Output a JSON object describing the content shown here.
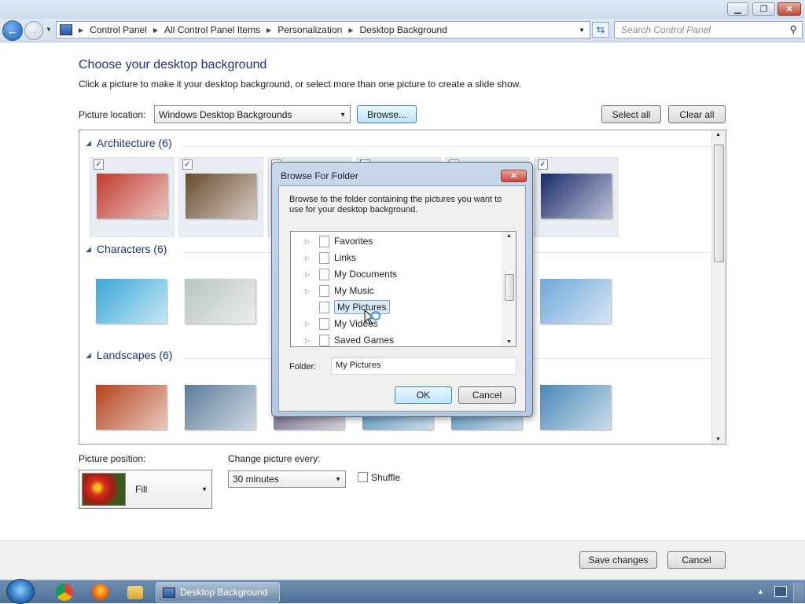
{
  "window": {
    "caption_buttons": [
      "minimize",
      "maximize",
      "close"
    ]
  },
  "address": {
    "crumbs": [
      "Control Panel",
      "All Control Panel Items",
      "Personalization",
      "Desktop Background"
    ],
    "search_placeholder": "Search Control Panel"
  },
  "page": {
    "title": "Choose your desktop background",
    "subtitle": "Click a picture to make it your desktop background, or select more than one picture to create a slide show.",
    "picture_location_label": "Picture location:",
    "picture_location_value": "Windows Desktop Backgrounds",
    "browse_label": "Browse...",
    "select_all_label": "Select all",
    "clear_all_label": "Clear all"
  },
  "gallery": {
    "groups": [
      {
        "title": "Architecture (6)",
        "checked": true,
        "colors": [
          "#c0392b",
          "#6a4a2b",
          "#8fa6c4",
          "#b8a88a",
          "#5a7a9a",
          "#1a2a6a"
        ]
      },
      {
        "title": "Characters (6)",
        "checked": false,
        "colors": [
          "#3aa7d8",
          "#b8c4c0",
          "#9bb0c2",
          "#c4d0dc",
          "#8ab0d0",
          "#6fa8d8"
        ]
      },
      {
        "title": "Landscapes (6)",
        "checked": false,
        "colors": [
          "#b4421c",
          "#5c7c9c",
          "#6a5a7c",
          "#4a88b8",
          "#4a88b8",
          "#4a88b8"
        ]
      }
    ]
  },
  "bottom": {
    "picture_position_label": "Picture position:",
    "picture_position_value": "Fill",
    "change_every_label": "Change picture every:",
    "change_every_value": "30 minutes",
    "shuffle_label": "Shuffle",
    "save_label": "Save changes",
    "cancel_label": "Cancel"
  },
  "dialog": {
    "title": "Browse For Folder",
    "description": "Browse to the folder containing the pictures you want to use for your desktop background.",
    "tree": [
      {
        "label": "Favorites",
        "expandable": true,
        "selected": false
      },
      {
        "label": "Links",
        "expandable": true,
        "selected": false
      },
      {
        "label": "My Documents",
        "expandable": true,
        "selected": false
      },
      {
        "label": "My Music",
        "expandable": true,
        "selected": false
      },
      {
        "label": "My Pictures",
        "expandable": false,
        "selected": true
      },
      {
        "label": "My Videos",
        "expandable": true,
        "selected": false
      },
      {
        "label": "Saved Games",
        "expandable": true,
        "selected": false
      }
    ],
    "folder_label": "Folder:",
    "folder_value": "My Pictures",
    "ok_label": "OK",
    "cancel_label": "Cancel"
  },
  "taskbar": {
    "active_window": "Desktop Background"
  }
}
